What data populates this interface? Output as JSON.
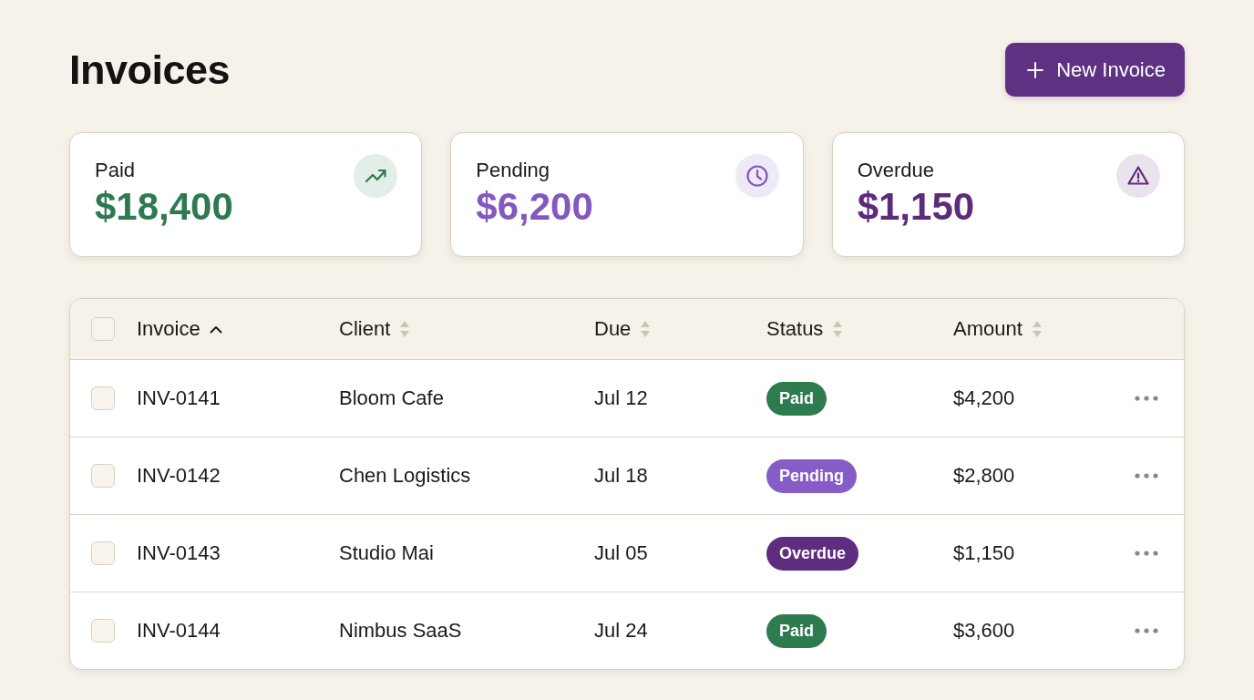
{
  "header": {
    "title": "Invoices",
    "new_button": {
      "label": "New Invoice"
    }
  },
  "summary_cards": [
    {
      "label": "Paid",
      "amount": "$18,400",
      "color": "#2e7a4f",
      "kind": "trend"
    },
    {
      "label": "Pending",
      "amount": "$6,200",
      "color": "#8358bf",
      "kind": "clock"
    },
    {
      "label": "Overdue",
      "amount": "$1,150",
      "color": "#5c2b7c",
      "kind": "warning"
    }
  ],
  "table": {
    "select_all": {
      "checked": false
    },
    "columns": [
      {
        "label": "Invoice",
        "sorted": true
      },
      {
        "label": "Client",
        "sorted": false
      },
      {
        "label": "Due",
        "sorted": false
      },
      {
        "label": "Status",
        "sorted": false
      },
      {
        "label": "Amount",
        "sorted": false
      }
    ],
    "rows": [
      {
        "checked": false,
        "invoice": "INV-0141",
        "client": "Bloom Cafe",
        "due": "Jul 12",
        "status": {
          "label": "Paid",
          "color": "#2f7b50"
        },
        "amount": "$4,200"
      },
      {
        "checked": false,
        "invoice": "INV-0142",
        "client": "Chen Logistics",
        "due": "Jul 18",
        "status": {
          "label": "Pending",
          "color": "#865cc6"
        },
        "amount": "$2,800"
      },
      {
        "checked": false,
        "invoice": "INV-0143",
        "client": "Studio Mai",
        "due": "Jul 05",
        "status": {
          "label": "Overdue",
          "color": "#5e2d80"
        },
        "amount": "$1,150"
      },
      {
        "checked": false,
        "invoice": "INV-0144",
        "client": "Nimbus SaaS",
        "due": "Jul 24",
        "status": {
          "label": "Paid",
          "color": "#2f7b50"
        },
        "amount": "$3,600"
      }
    ]
  }
}
